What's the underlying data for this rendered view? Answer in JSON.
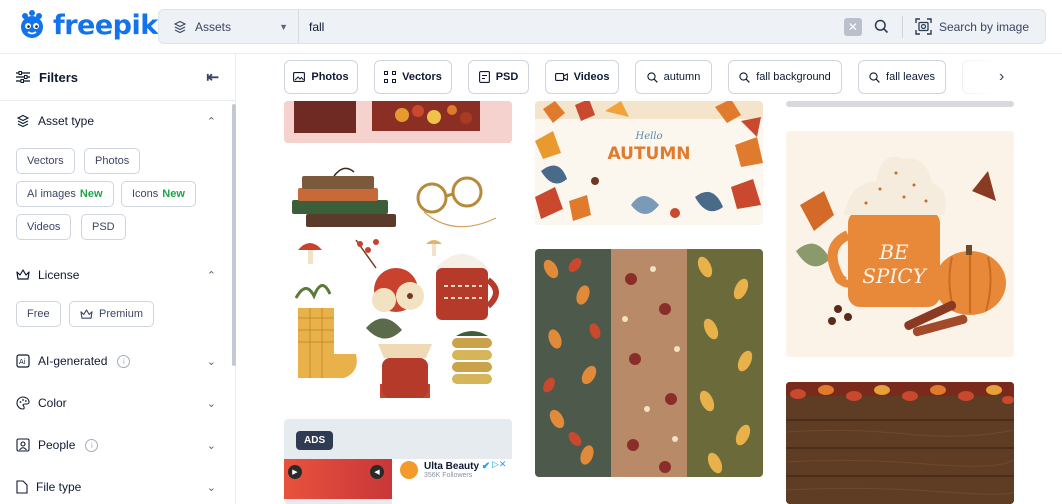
{
  "brand": {
    "name": "freepik",
    "color": "#1273eb"
  },
  "search": {
    "asset_type": "Assets",
    "query": "fall",
    "search_by_image": "Search by image"
  },
  "sidebar": {
    "title": "Filters",
    "asset_type": {
      "title": "Asset type",
      "chips": [
        "Vectors",
        "Photos",
        "AI images",
        "Icons",
        "Videos",
        "PSD"
      ],
      "new_label": "New"
    },
    "license": {
      "title": "License",
      "chips": [
        "Free",
        "Premium"
      ]
    },
    "ai_generated": "AI-generated",
    "color": "Color",
    "people": "People",
    "file_type": "File type"
  },
  "filterbar": {
    "chips": [
      "Photos",
      "Vectors",
      "PSD",
      "Videos",
      "autumn",
      "fall background",
      "fall leaves"
    ]
  },
  "ad": {
    "badge": "ADS",
    "advertiser": "Ulta Beauty",
    "followers": "356K Followers"
  },
  "gallery": {
    "hello": "Hello",
    "autumn": "AUTUMN",
    "be": "BE",
    "spicy": "SPICY"
  }
}
